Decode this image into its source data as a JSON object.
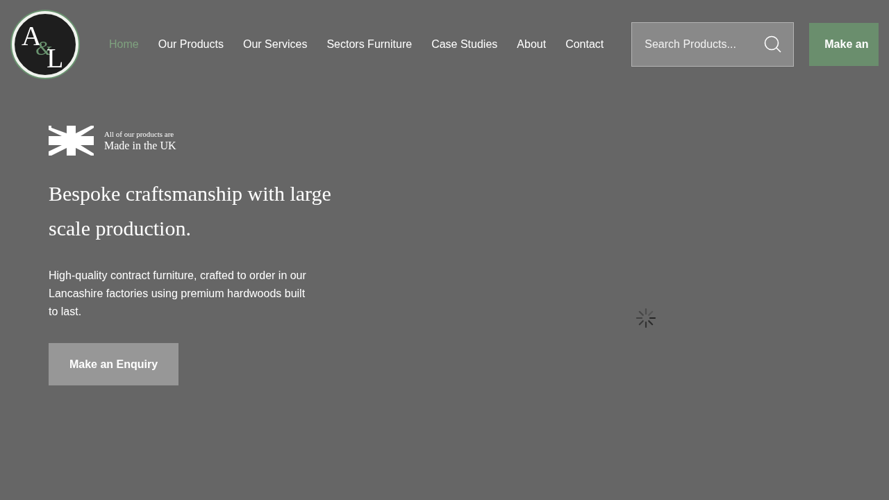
{
  "logo": {
    "letters": [
      "A",
      "&",
      "L"
    ]
  },
  "nav": [
    {
      "label": "Home",
      "selected": true
    },
    {
      "label": "Our Products",
      "selected": false
    },
    {
      "label": "Our Services",
      "selected": false
    },
    {
      "label": "Sectors Furniture",
      "selected": false
    },
    {
      "label": "Case Studies",
      "selected": false
    },
    {
      "label": "About",
      "selected": false
    },
    {
      "label": "Contact",
      "selected": false
    }
  ],
  "search": {
    "placeholder": "Search Products..."
  },
  "header_button": "Make an",
  "hero": {
    "badge_small": "All of our products are",
    "badge_large": "Made in the UK",
    "heading": "Bespoke craftsmanship with large scale production.",
    "text": "High-quality contract furniture, crafted to order in our Lancashire factories using premium hardwoods built to last.",
    "button": "Make an Enquiry"
  }
}
